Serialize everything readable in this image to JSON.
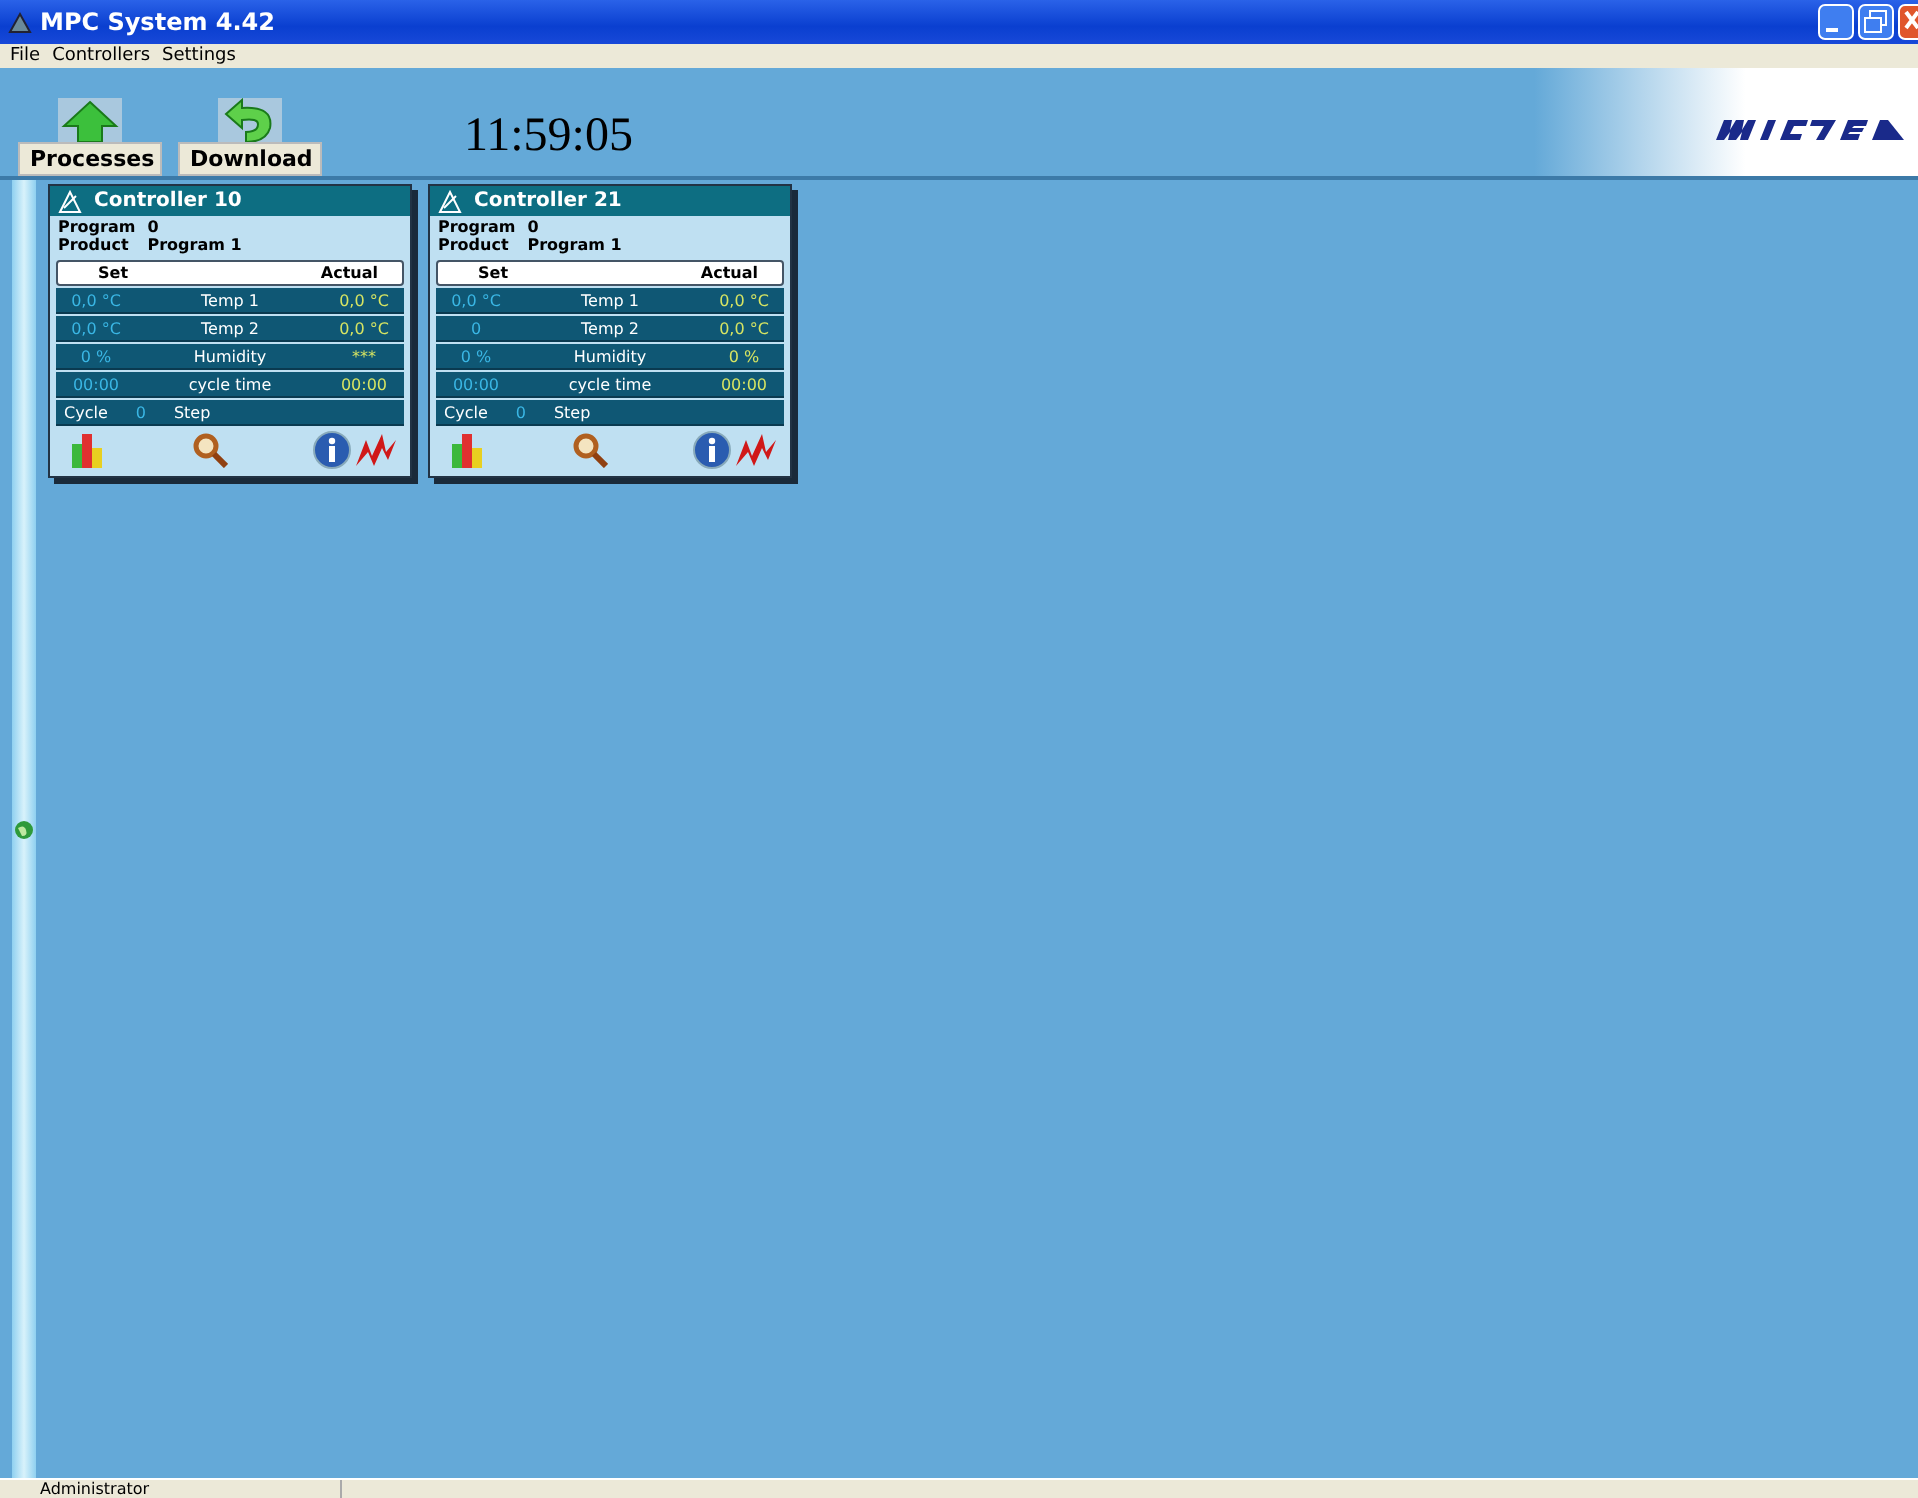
{
  "window": {
    "title": "MPC System 4.42"
  },
  "menu": [
    "File",
    "Controllers",
    "Settings"
  ],
  "toolbar": [
    {
      "label": "Processes",
      "kind": "home"
    },
    {
      "label": "Download",
      "kind": "back"
    }
  ],
  "clock": "11:59:05",
  "controllers": [
    {
      "title": "Controller 10",
      "fields": [
        {
          "label": "Program",
          "value": "0"
        },
        {
          "label": "Product",
          "value": "Program 1"
        }
      ],
      "columns": [
        "Set",
        "Actual"
      ],
      "rows": [
        {
          "set": "0,0 °C",
          "label": "Temp 1",
          "actual": "0,0 °C"
        },
        {
          "set": "0,0 °C",
          "label": "Temp 2",
          "actual": "0,0 °C"
        },
        {
          "set": "0 %",
          "label": "Humidity",
          "actual": "***"
        },
        {
          "set": "00:00",
          "label": "cycle time",
          "actual": "00:00"
        }
      ],
      "cycle": {
        "label": "Cycle",
        "value": "0",
        "step": "Step"
      }
    },
    {
      "title": "Controller 21",
      "fields": [
        {
          "label": "Program",
          "value": "0"
        },
        {
          "label": "Product",
          "value": "Program 1"
        }
      ],
      "columns": [
        "Set",
        "Actual"
      ],
      "rows": [
        {
          "set": "0,0 °C",
          "label": "Temp 1",
          "actual": "0,0 °C"
        },
        {
          "set": "0",
          "label": "Temp 2",
          "actual": "0,0 °C"
        },
        {
          "set": "0 %",
          "label": "Humidity",
          "actual": "0 %"
        },
        {
          "set": "00:00",
          "label": "cycle time",
          "actual": "00:00"
        }
      ],
      "cycle": {
        "label": "Cycle",
        "value": "0",
        "step": "Step"
      }
    }
  ],
  "status_bar": [
    "Administrator"
  ]
}
